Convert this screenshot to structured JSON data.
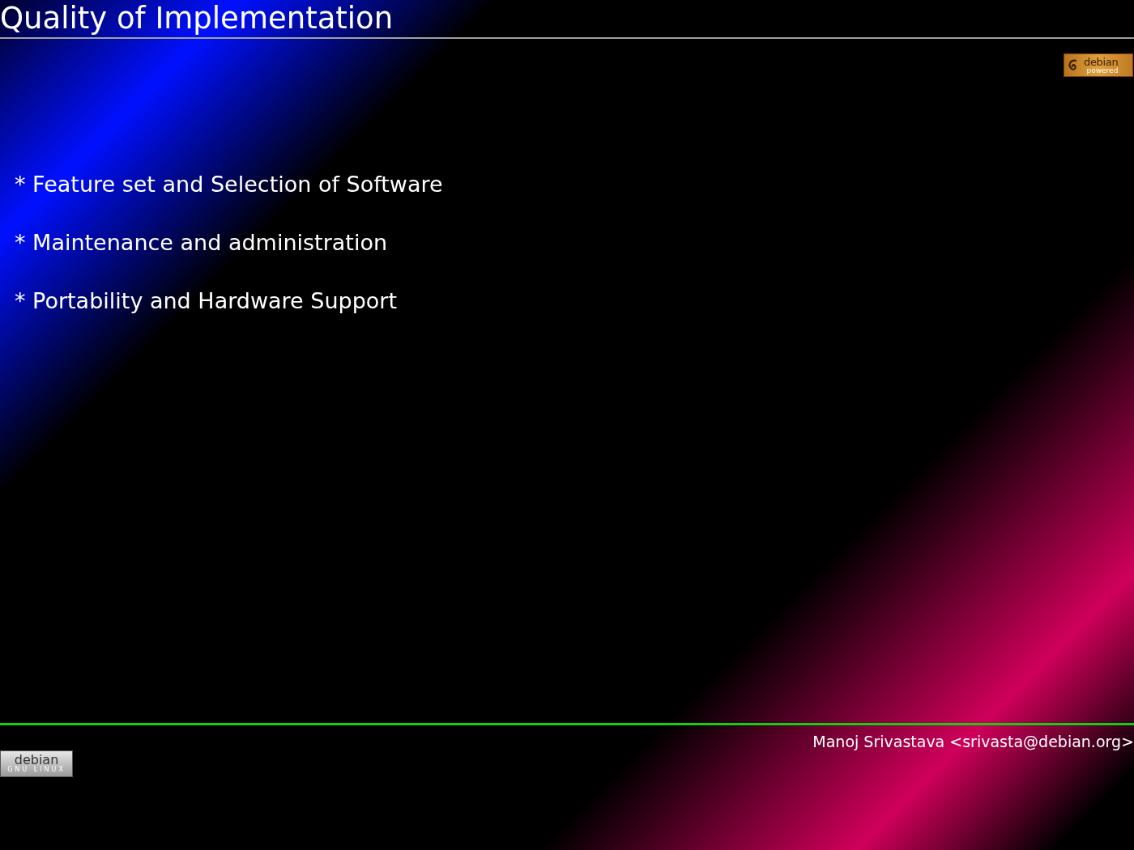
{
  "title": "Quality of Implementation",
  "top_badge": {
    "line_1": "debian",
    "line_2": "powered"
  },
  "bullets": [
    "* Feature set and Selection of Software",
    "* Maintenance and administration",
    "* Portability and Hardware Support"
  ],
  "footer": {
    "author": "Manoj Srivastava <srivasta@debian.org>",
    "badge": {
      "line_1": "debian",
      "line_2": "GNU LINUX"
    }
  }
}
